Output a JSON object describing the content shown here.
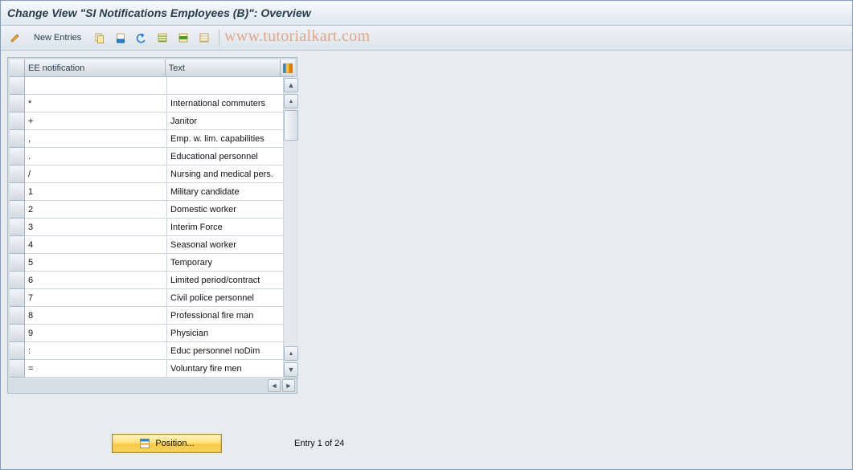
{
  "title": "Change View \"SI Notifications Employees (B)\": Overview",
  "toolbar": {
    "new_entries_label": "New Entries"
  },
  "watermark": "www.tutorialkart.com",
  "table": {
    "headers": {
      "col1": "EE notification",
      "col2": "Text"
    },
    "rows": [
      {
        "key": "",
        "text": ""
      },
      {
        "key": "*",
        "text": "International commuters"
      },
      {
        "key": "+",
        "text": "Janitor"
      },
      {
        "key": ",",
        "text": "Emp. w. lim. capabilities"
      },
      {
        "key": ".",
        "text": "Educational personnel"
      },
      {
        "key": "/",
        "text": "Nursing and medical pers."
      },
      {
        "key": "1",
        "text": "Military candidate"
      },
      {
        "key": "2",
        "text": "Domestic worker"
      },
      {
        "key": "3",
        "text": "Interim Force"
      },
      {
        "key": "4",
        "text": "Seasonal worker"
      },
      {
        "key": "5",
        "text": "Temporary"
      },
      {
        "key": "6",
        "text": "Limited period/contract"
      },
      {
        "key": "7",
        "text": "Civil police personnel"
      },
      {
        "key": "8",
        "text": "Professional fire man"
      },
      {
        "key": "9",
        "text": "Physician"
      },
      {
        "key": ":",
        "text": "Educ personnel noDim"
      },
      {
        "key": "=",
        "text": "Voluntary fire men"
      }
    ]
  },
  "position_button_label": "Position...",
  "entry_status": "Entry 1 of 24"
}
